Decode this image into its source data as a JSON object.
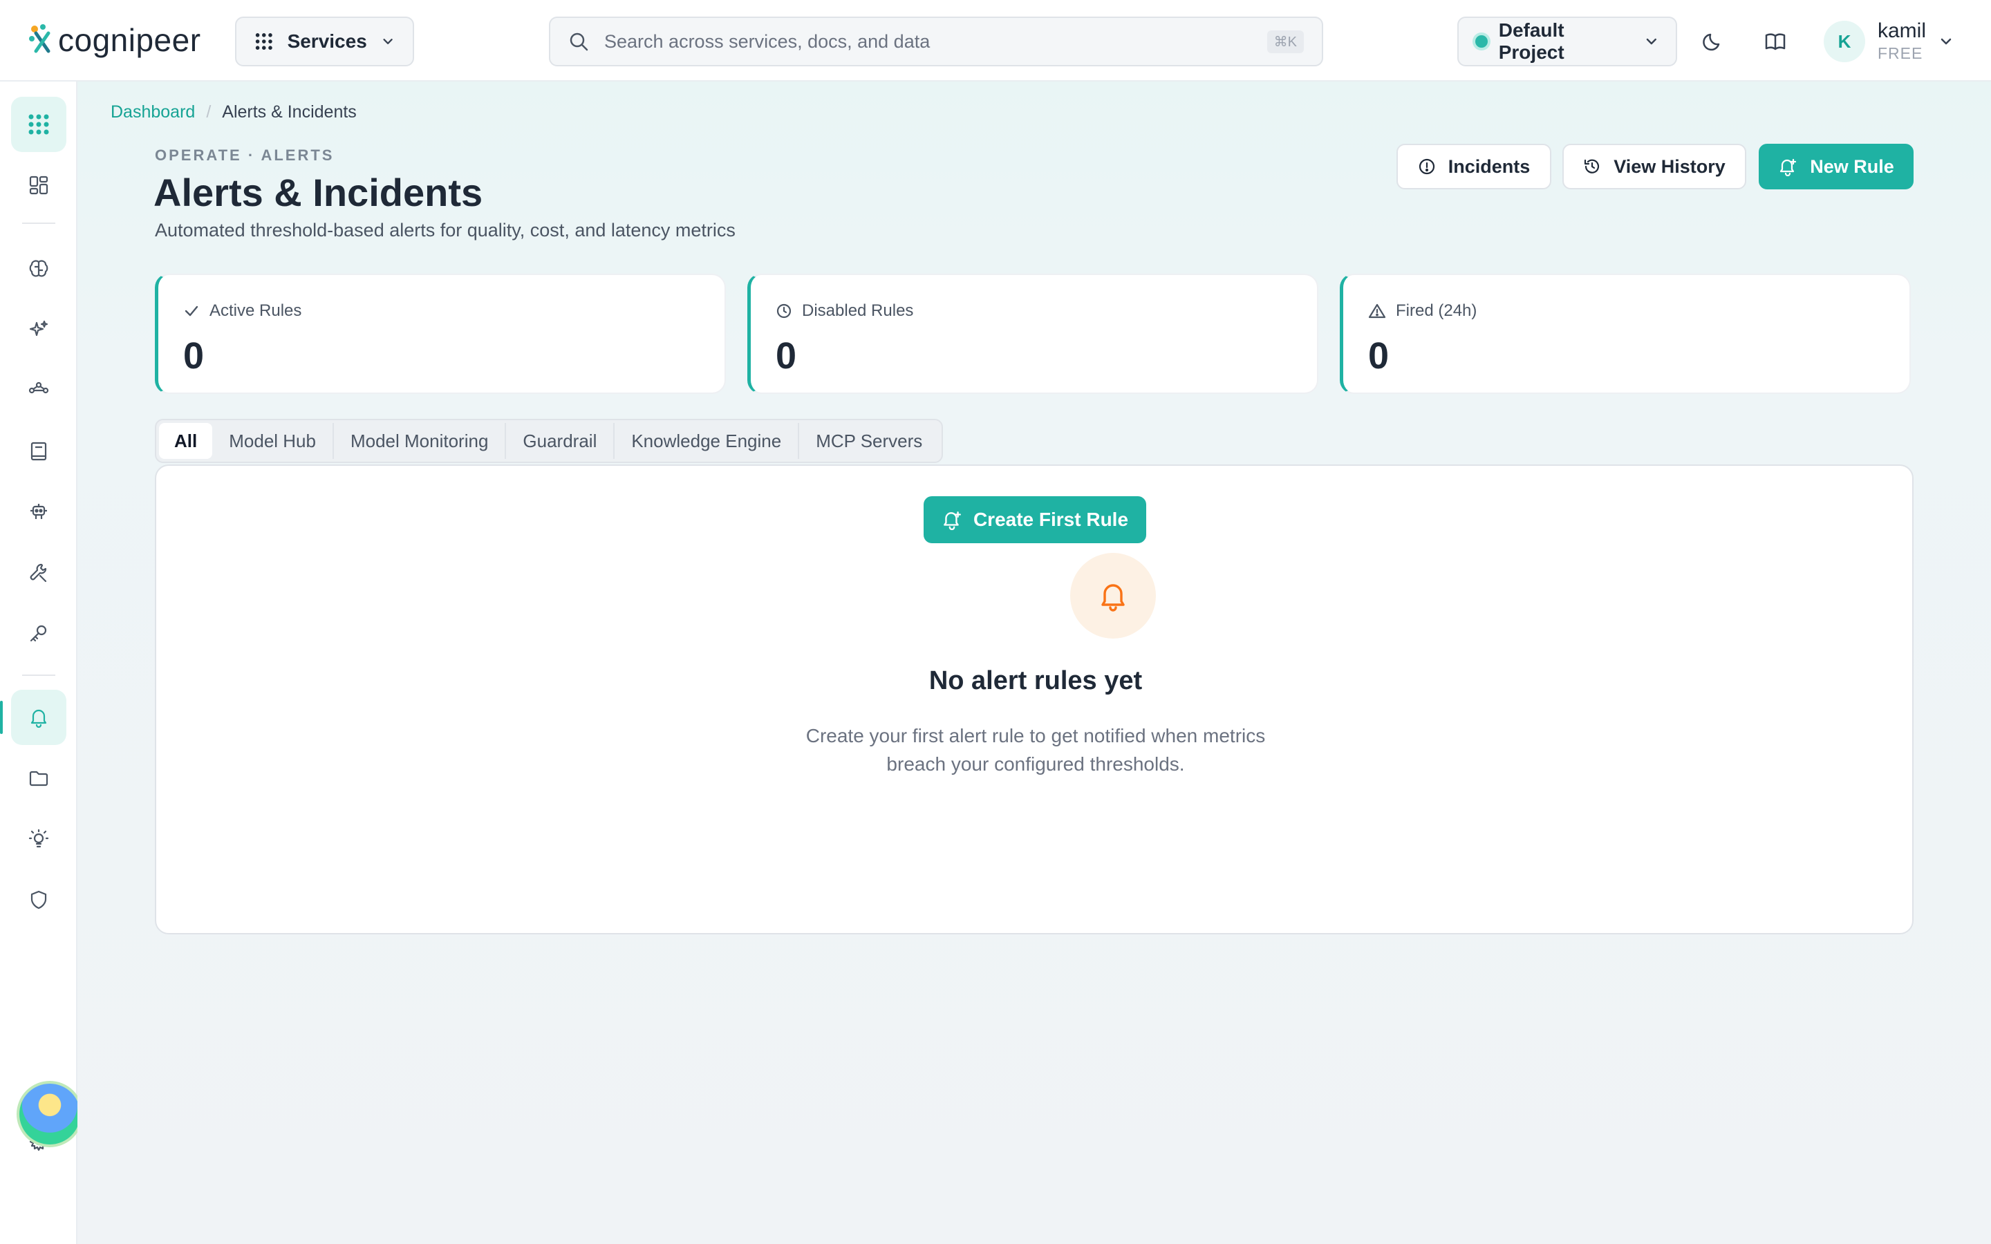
{
  "brand": {
    "name": "cognipeer"
  },
  "topbar": {
    "services_label": "Services",
    "search_placeholder": "Search across services, docs, and data",
    "search_shortcut": "⌘K",
    "project_label": "Default Project",
    "user": {
      "initial": "K",
      "name": "kamil",
      "plan": "FREE"
    }
  },
  "sidebar": {
    "items": [
      {
        "icon": "grid-dots-icon",
        "active": true
      },
      {
        "icon": "dashboard-icon"
      },
      {
        "icon": "brain-icon"
      },
      {
        "icon": "sparkles-icon"
      },
      {
        "icon": "route-icon"
      },
      {
        "icon": "book-icon"
      },
      {
        "icon": "robot-icon"
      },
      {
        "icon": "tools-icon"
      },
      {
        "icon": "key-icon"
      },
      {
        "icon": "bell-icon",
        "active": true
      },
      {
        "icon": "folder-icon"
      },
      {
        "icon": "bulb-icon"
      },
      {
        "icon": "shield-icon"
      },
      {
        "icon": "gear-icon"
      }
    ]
  },
  "breadcrumb": {
    "root": "Dashboard",
    "separator": "/",
    "current": "Alerts & Incidents"
  },
  "header": {
    "eyebrow": "OPERATE · ALERTS",
    "title": "Alerts & Incidents",
    "subtitle": "Automated threshold-based alerts for quality, cost, and latency metrics",
    "buttons": {
      "incidents": "Incidents",
      "history": "View History",
      "new_rule": "New Rule"
    }
  },
  "stats": [
    {
      "label": "Active Rules",
      "value": "0",
      "icon": "check-icon"
    },
    {
      "label": "Disabled Rules",
      "value": "0",
      "icon": "clock-icon"
    },
    {
      "label": "Fired (24h)",
      "value": "0",
      "icon": "warning-icon"
    }
  ],
  "tabs": [
    "All",
    "Model Hub",
    "Model Monitoring",
    "Guardrail",
    "Knowledge Engine",
    "MCP Servers"
  ],
  "empty_state": {
    "title": "No alert rules yet",
    "description_line1": "Create your first alert rule to get notified when metrics",
    "description_line2": "breach your configured thresholds.",
    "cta": "Create First Rule"
  },
  "colors": {
    "accent": "#1fb2a3",
    "warning_bg": "#fdf1e4",
    "warning": "#f97316"
  }
}
